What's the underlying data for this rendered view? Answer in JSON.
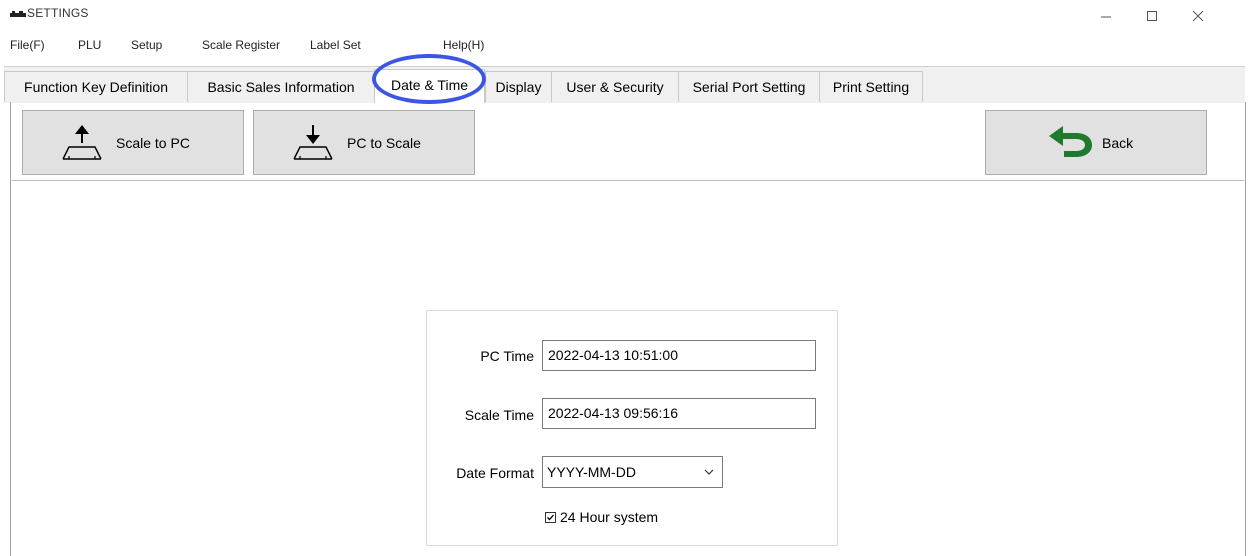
{
  "window": {
    "title": "SETTINGS"
  },
  "menu": {
    "items": [
      "File(F)",
      "PLU",
      "Setup",
      "Scale Register",
      "Label Set",
      "Help(H)"
    ]
  },
  "tabs": [
    {
      "label": "Function Key Definition"
    },
    {
      "label": "Basic Sales Information"
    },
    {
      "label": "Date & Time",
      "active": true
    },
    {
      "label": "Display"
    },
    {
      "label": "User & Security"
    },
    {
      "label": "Serial Port Setting"
    },
    {
      "label": "Print Setting"
    }
  ],
  "toolbar": {
    "scale_to_pc": "Scale to PC",
    "pc_to_scale": "PC to Scale",
    "back": "Back"
  },
  "form": {
    "pc_time_label": "PC Time",
    "pc_time_value": "2022-04-13 10:51:00",
    "scale_time_label": "Scale Time",
    "scale_time_value": "2022-04-13 09:56:16",
    "date_format_label": "Date Format",
    "date_format_value": "YYYY-MM-DD",
    "hour_system_label": "24 Hour system",
    "hour_system_checked": true
  },
  "colors": {
    "highlight_ring": "#3b55e6",
    "back_arrow": "#1f7a2e",
    "button_face": "#e1e1e1"
  },
  "icons": {
    "scale_to_pc": "scale-upload-icon",
    "pc_to_scale": "scale-download-icon",
    "back": "back-arrow-icon"
  }
}
